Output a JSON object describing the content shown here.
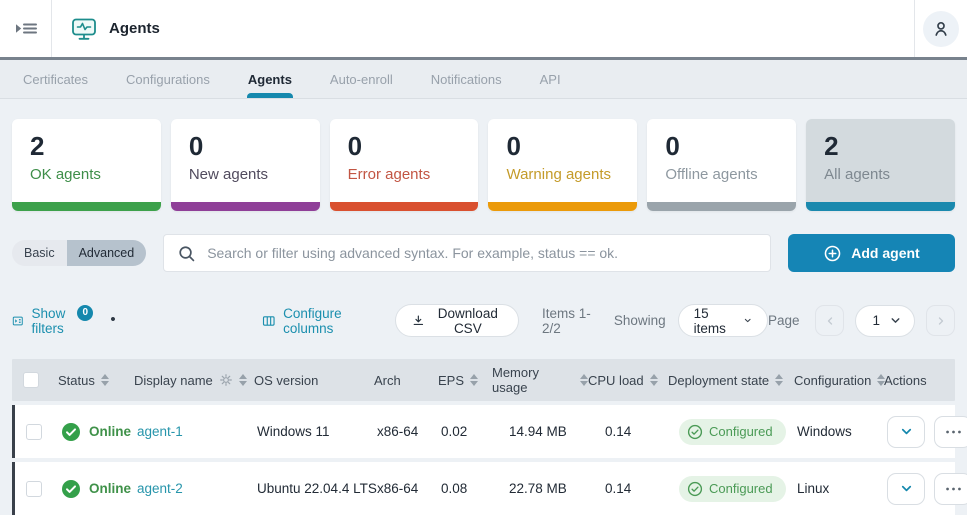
{
  "app": {
    "title": "Agents",
    "accent_color": "#1588ad",
    "link_color": "#2795ab"
  },
  "tabs": [
    {
      "label": "Certificates",
      "active": false
    },
    {
      "label": "Configurations",
      "active": false
    },
    {
      "label": "Agents",
      "active": true
    },
    {
      "label": "Auto-enroll",
      "active": false
    },
    {
      "label": "Notifications",
      "active": false
    },
    {
      "label": "API",
      "active": false
    }
  ],
  "summary_cards": [
    {
      "value": "2",
      "label": "OK agents",
      "color": "#3da14b",
      "selected": false
    },
    {
      "value": "0",
      "label": "New agents",
      "color": "#8f3f98",
      "selected": false
    },
    {
      "value": "0",
      "label": "Error agents",
      "color": "#d9502f",
      "selected": false
    },
    {
      "value": "0",
      "label": "Warning agents",
      "color": "#eb9a0a",
      "selected": false
    },
    {
      "value": "0",
      "label": "Offline agents",
      "color": "#9aa4ab",
      "selected": false
    },
    {
      "value": "2",
      "label": "All agents",
      "color": "#1a89ae",
      "selected": true
    }
  ],
  "filter_bar": {
    "basic_label": "Basic",
    "advanced_label": "Advanced",
    "selected_mode": "Advanced",
    "search_placeholder": "Search or filter using advanced syntax. For example, status == ok.",
    "add_agent_label": "Add agent"
  },
  "toolbar": {
    "show_filters_label": "Show filters",
    "show_filters_badge": "0",
    "unsaved_dot": "•",
    "configure_columns_label": "Configure columns",
    "download_csv_label": "Download CSV",
    "items_range": "Items 1-2/2",
    "showing_label": "Showing",
    "page_size": "15 items",
    "page_label": "Page",
    "current_page": "1"
  },
  "table": {
    "columns": [
      {
        "label": "Status"
      },
      {
        "label": "Display name"
      },
      {
        "label": "OS version"
      },
      {
        "label": "Arch"
      },
      {
        "label": "EPS"
      },
      {
        "label": "Memory usage"
      },
      {
        "label": "CPU load"
      },
      {
        "label": "Deployment state"
      },
      {
        "label": "Configuration"
      },
      {
        "label": "Actions"
      }
    ],
    "rows": [
      {
        "status": "Online",
        "display_name": "agent-1",
        "os_version": "Windows 11",
        "arch": "x86-64",
        "eps": "0.02",
        "memory_usage": "14.94 MB",
        "cpu_load": "0.14",
        "deployment_state": "Configured",
        "configuration": "Windows"
      },
      {
        "status": "Online",
        "display_name": "agent-2",
        "os_version": "Ubuntu 22.04.4 LTS",
        "arch": "x86-64",
        "eps": "0.08",
        "memory_usage": "22.78 MB",
        "cpu_load": "0.14",
        "deployment_state": "Configured",
        "configuration": "Linux"
      }
    ],
    "status_colors": {
      "online": "#3f9149",
      "configured_bg": "#e5f3e6"
    }
  },
  "icons": {
    "sidebar_toggle": "panel-collapse",
    "agents": "monitor-pulse",
    "user": "person",
    "search": "magnifier",
    "add": "plus-circle",
    "show_filters": "filter-panel",
    "configure_columns": "columns",
    "download": "arrow-down-tray",
    "dropdown": "chevron-down",
    "row_expand": "chevron-down",
    "row_menu": "ellipsis",
    "online": "check-circle-filled",
    "configured": "check-circle-outline",
    "column_settings": "gear",
    "sort": "up-down-arrows"
  }
}
